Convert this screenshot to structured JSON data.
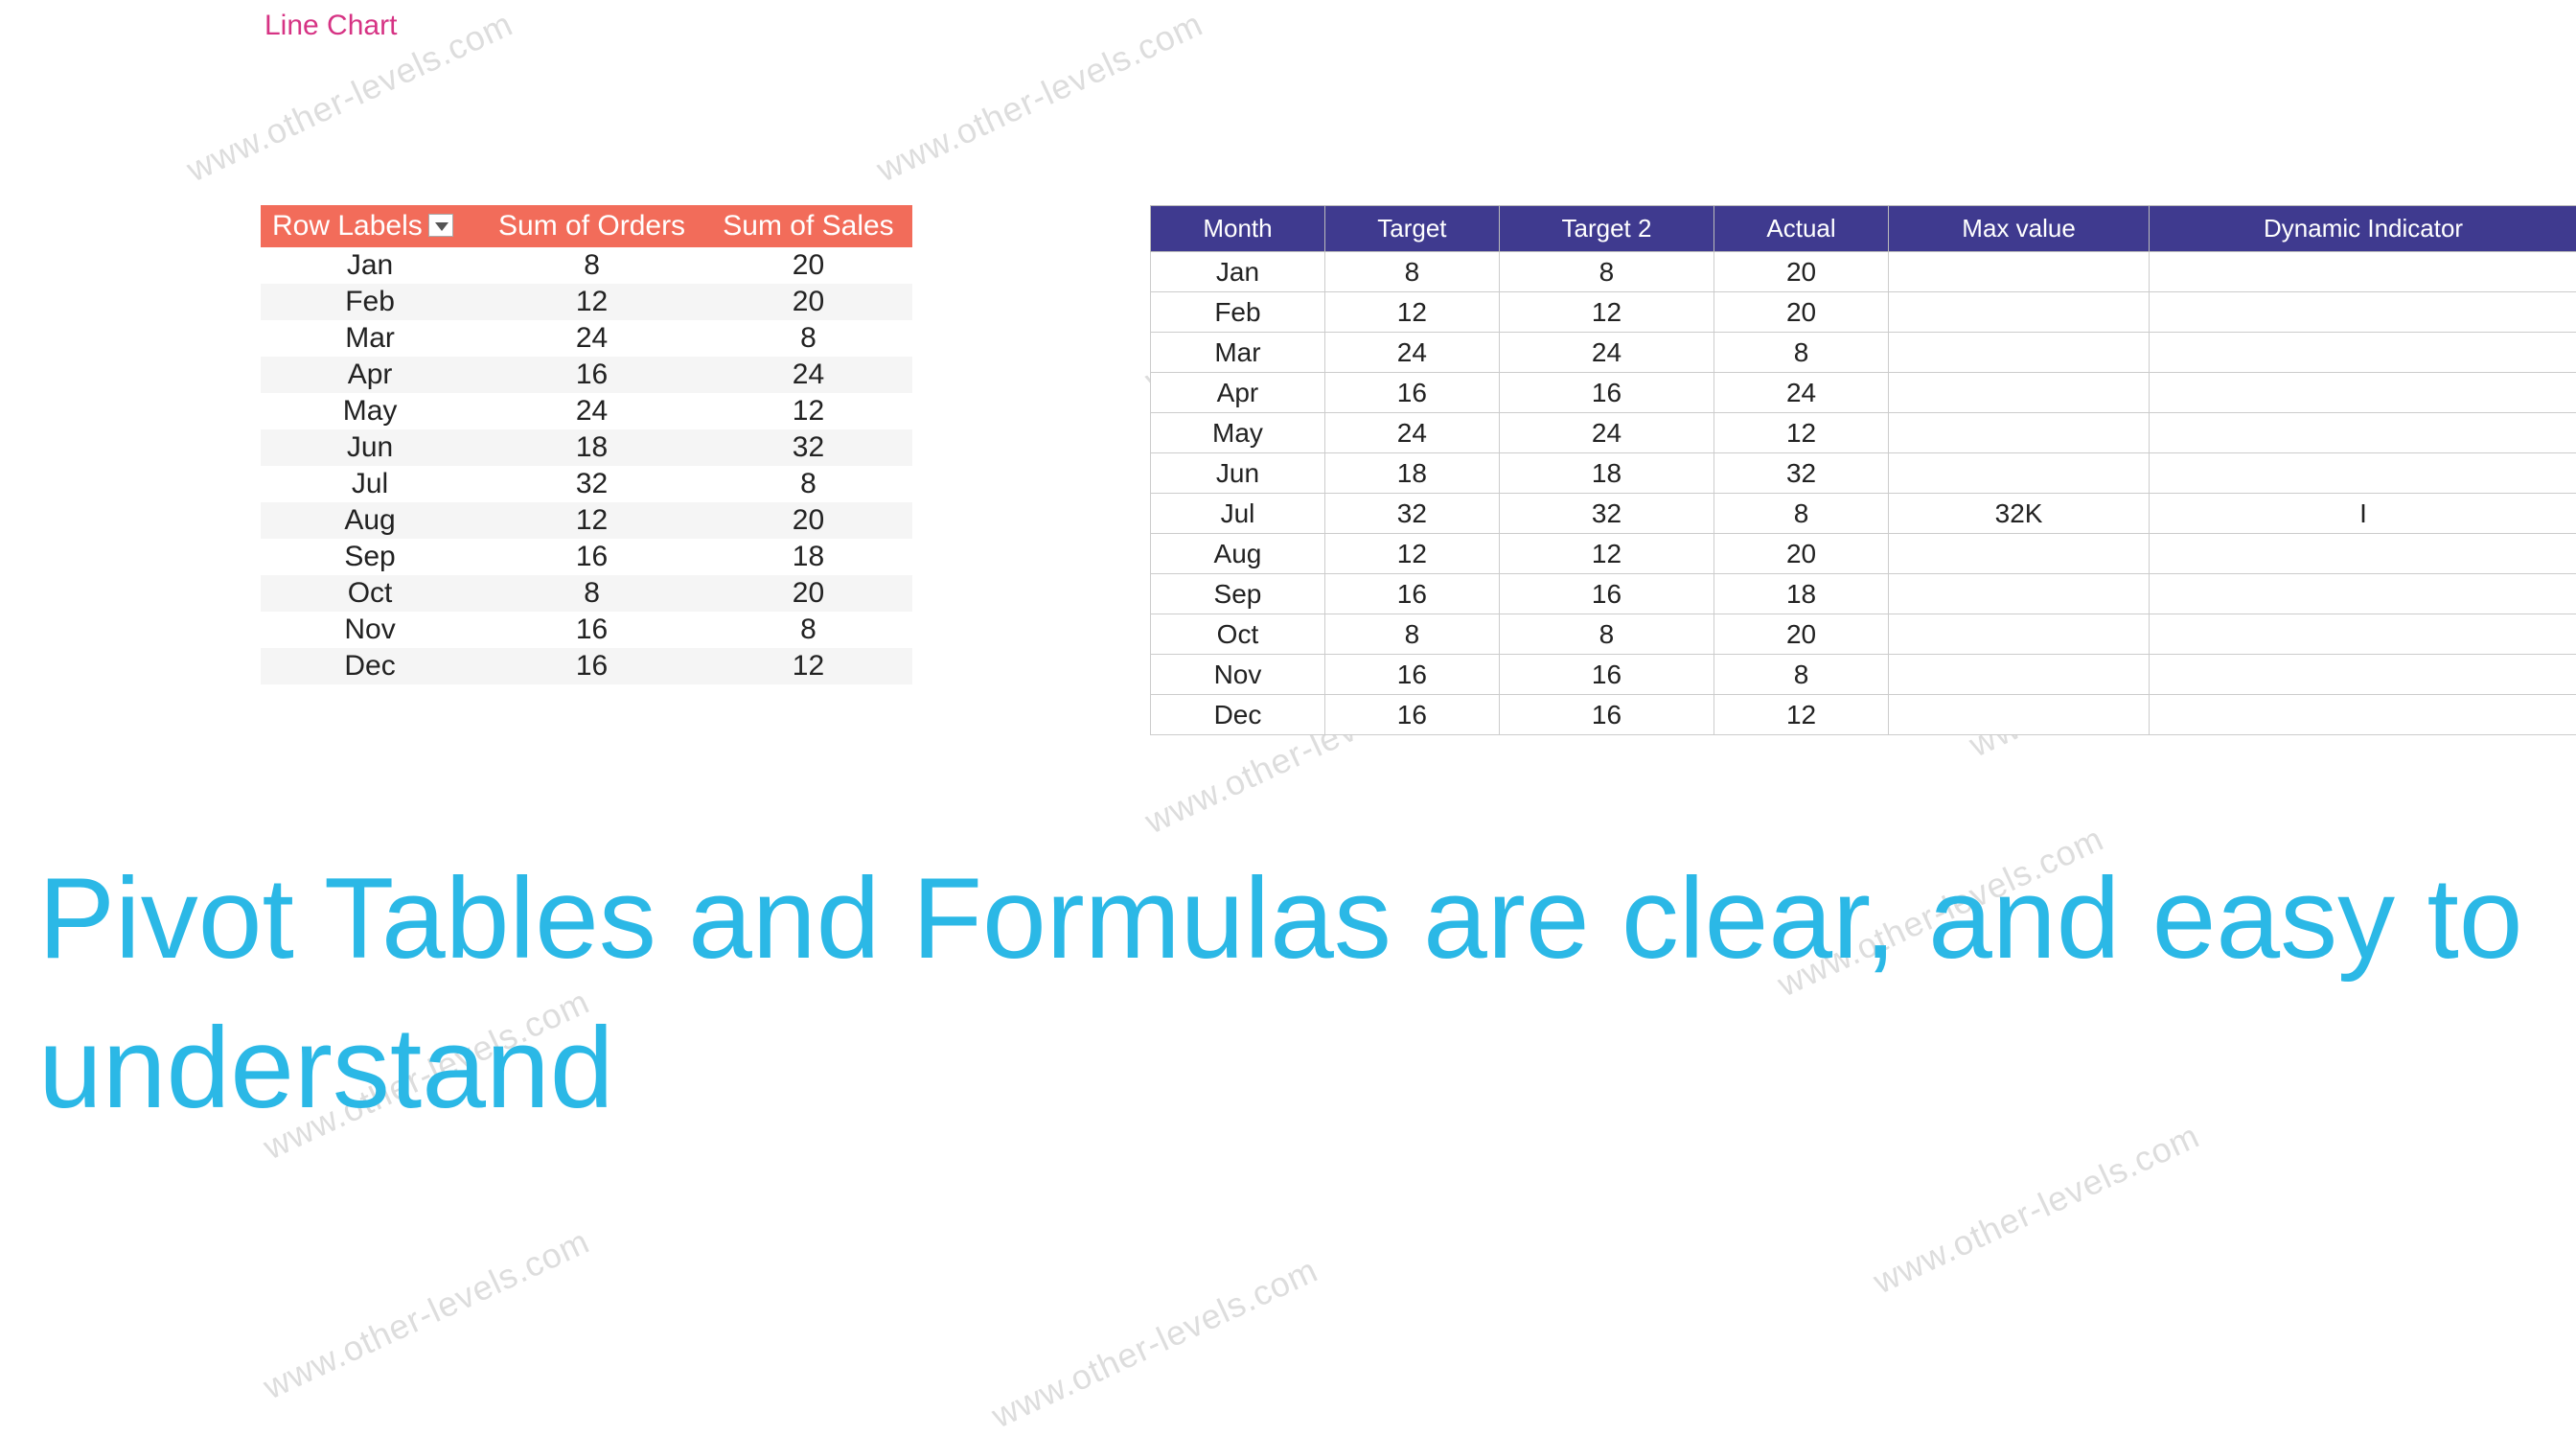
{
  "watermark_text": "www.other-levels.com",
  "chart_title": "Line Chart",
  "pivot": {
    "headers": [
      "Row Labels",
      "Sum of Orders",
      "Sum of Sales"
    ],
    "rows": [
      {
        "month": "Jan",
        "orders": "8",
        "sales": "20"
      },
      {
        "month": "Feb",
        "orders": "12",
        "sales": "20"
      },
      {
        "month": "Mar",
        "orders": "24",
        "sales": "8"
      },
      {
        "month": "Apr",
        "orders": "16",
        "sales": "24"
      },
      {
        "month": "May",
        "orders": "24",
        "sales": "12"
      },
      {
        "month": "Jun",
        "orders": "18",
        "sales": "32"
      },
      {
        "month": "Jul",
        "orders": "32",
        "sales": "8"
      },
      {
        "month": "Aug",
        "orders": "12",
        "sales": "20"
      },
      {
        "month": "Sep",
        "orders": "16",
        "sales": "18"
      },
      {
        "month": "Oct",
        "orders": "8",
        "sales": "20"
      },
      {
        "month": "Nov",
        "orders": "16",
        "sales": "8"
      },
      {
        "month": "Dec",
        "orders": "16",
        "sales": "12"
      }
    ]
  },
  "data_table": {
    "headers": [
      "Month",
      "Target",
      "Target 2",
      "Actual",
      "Max value",
      "Dynamic Indicator"
    ],
    "rows": [
      {
        "month": "Jan",
        "target": "8",
        "target2": "8",
        "actual": "20",
        "max": "",
        "dyn": ""
      },
      {
        "month": "Feb",
        "target": "12",
        "target2": "12",
        "actual": "20",
        "max": "",
        "dyn": ""
      },
      {
        "month": "Mar",
        "target": "24",
        "target2": "24",
        "actual": "8",
        "max": "",
        "dyn": ""
      },
      {
        "month": "Apr",
        "target": "16",
        "target2": "16",
        "actual": "24",
        "max": "",
        "dyn": ""
      },
      {
        "month": "May",
        "target": "24",
        "target2": "24",
        "actual": "12",
        "max": "",
        "dyn": ""
      },
      {
        "month": "Jun",
        "target": "18",
        "target2": "18",
        "actual": "32",
        "max": "",
        "dyn": ""
      },
      {
        "month": "Jul",
        "target": "32",
        "target2": "32",
        "actual": "8",
        "max": "32K",
        "dyn": "I"
      },
      {
        "month": "Aug",
        "target": "12",
        "target2": "12",
        "actual": "20",
        "max": "",
        "dyn": ""
      },
      {
        "month": "Sep",
        "target": "16",
        "target2": "16",
        "actual": "18",
        "max": "",
        "dyn": ""
      },
      {
        "month": "Oct",
        "target": "8",
        "target2": "8",
        "actual": "20",
        "max": "",
        "dyn": ""
      },
      {
        "month": "Nov",
        "target": "16",
        "target2": "16",
        "actual": "8",
        "max": "",
        "dyn": ""
      },
      {
        "month": "Dec",
        "target": "16",
        "target2": "16",
        "actual": "12",
        "max": "",
        "dyn": ""
      }
    ]
  },
  "caption": "Pivot Tables and Formulas are clear, and easy to understand"
}
